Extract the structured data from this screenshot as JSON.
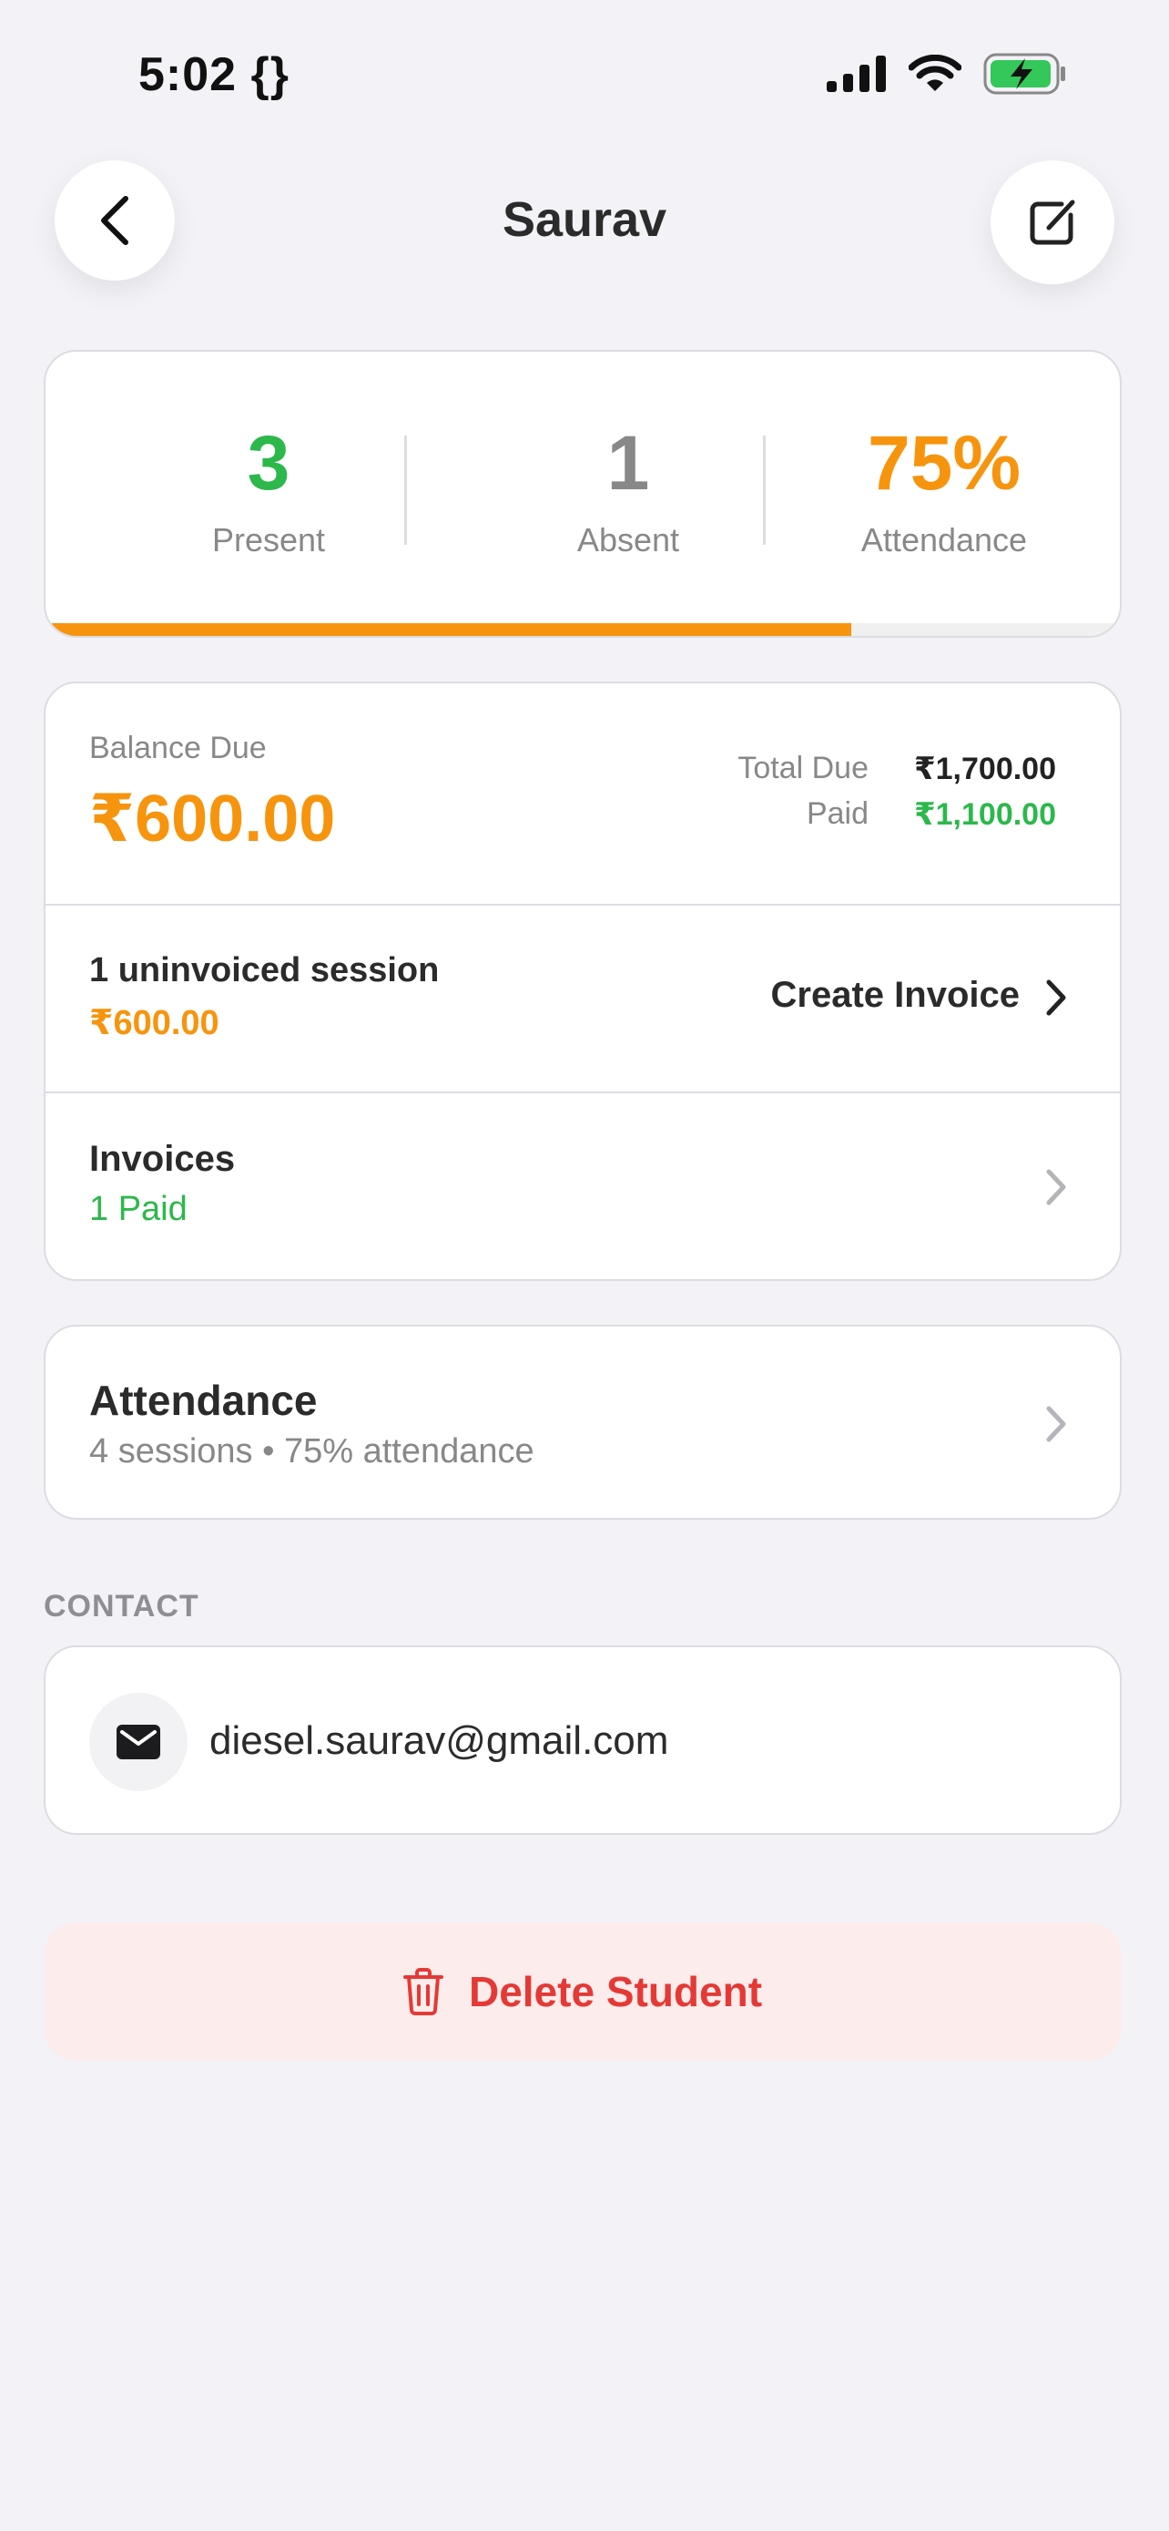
{
  "status_bar": {
    "time": "5:02 {}"
  },
  "header": {
    "title": "Saurav"
  },
  "stats": {
    "present": {
      "value": "3",
      "label": "Present",
      "color": "#2cb84b"
    },
    "absent": {
      "value": "1",
      "label": "Absent",
      "color": "#888888"
    },
    "attendance": {
      "value": "75%",
      "label": "Attendance",
      "color": "#f7940e"
    },
    "progress_fraction": 0.75
  },
  "finance": {
    "balance_label": "Balance Due",
    "balance_value": "₹600.00",
    "total_due_label": "Total Due",
    "total_due_value": "₹1,700.00",
    "paid_label": "Paid",
    "paid_value": "₹1,100.00",
    "uninvoiced_title": "1 uninvoiced session",
    "uninvoiced_amount": "₹600.00",
    "create_invoice_label": "Create Invoice",
    "invoices_title": "Invoices",
    "invoices_sub": "1 Paid"
  },
  "attendance_card": {
    "title": "Attendance",
    "subtitle": "4 sessions • 75% attendance"
  },
  "contact": {
    "section_label": "CONTACT",
    "email": "diesel.saurav@gmail.com"
  },
  "actions": {
    "delete_label": "Delete Student"
  },
  "colors": {
    "accent": "#f7940e",
    "success": "#2cb84b",
    "danger": "#e53935"
  }
}
